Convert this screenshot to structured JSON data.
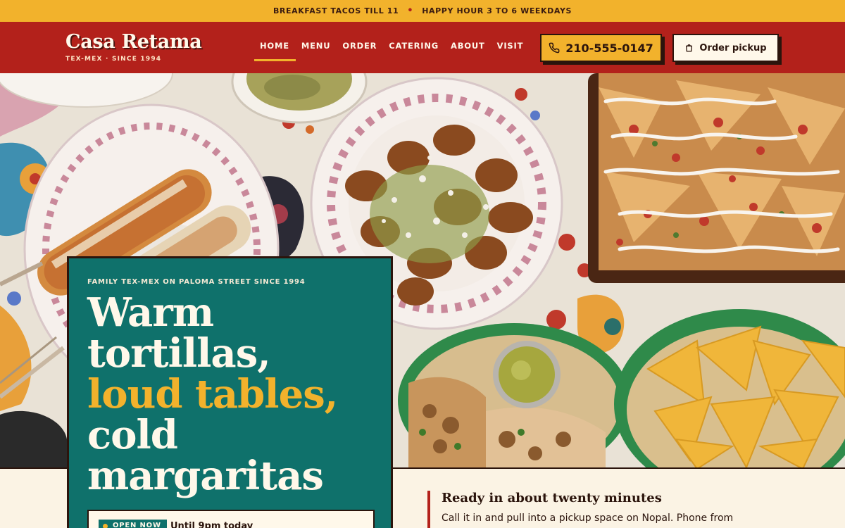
{
  "announcement": {
    "left": "BREAKFAST TACOS TILL 11",
    "right": "HAPPY HOUR 3 TO 6 WEEKDAYS",
    "separator": "•"
  },
  "brand": {
    "name": "Casa Retama",
    "tagline": "TEX-MEX · SINCE 1994"
  },
  "nav": {
    "items": [
      {
        "label": "HOME",
        "active": true
      },
      {
        "label": "MENU"
      },
      {
        "label": "ORDER"
      },
      {
        "label": "CATERING"
      },
      {
        "label": "ABOUT"
      },
      {
        "label": "VISIT"
      }
    ]
  },
  "header_actions": {
    "phone": "210-555-0147",
    "phone_icon": "phone-icon",
    "pickup_label": "Order pickup",
    "pickup_icon": "shopping-bag-icon"
  },
  "hero": {
    "eyebrow": "FAMILY TEX-MEX ON PALOMA STREET SINCE 1994",
    "headline_line1": "Warm",
    "headline_line2": "tortillas,",
    "headline_highlight": "loud tables,",
    "headline_line4": "cold",
    "headline_line5": "margaritas",
    "open_badge": "OPEN NOW",
    "open_hours": "Until 9pm today"
  },
  "ready": {
    "title": "Ready in about twenty minutes",
    "text": "Call it in and pull into a pickup space on Nopal. Phone from"
  },
  "colors": {
    "accent_yellow": "#f2b22c",
    "brand_red": "#b3211b",
    "teal": "#0f716b",
    "cream": "#fff8ea",
    "ink": "#2b140c"
  }
}
